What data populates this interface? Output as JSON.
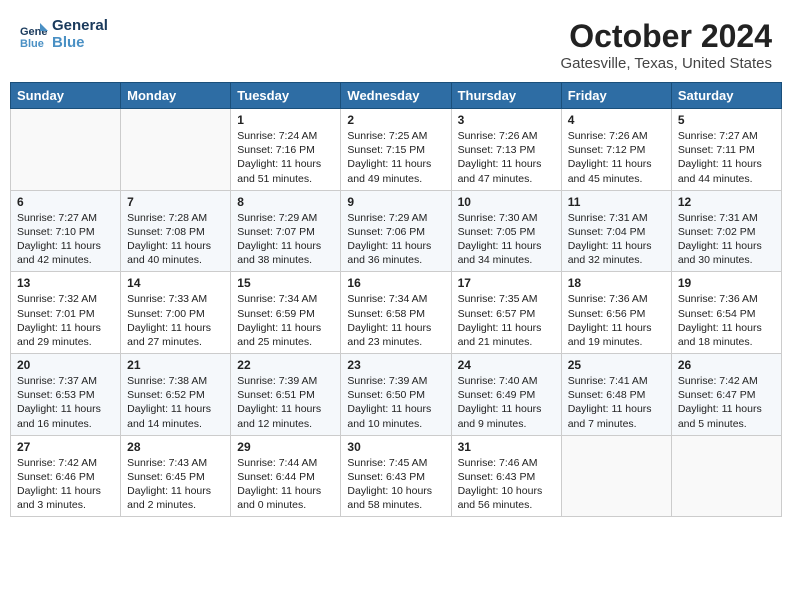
{
  "header": {
    "logo_line1": "General",
    "logo_line2": "Blue",
    "title": "October 2024",
    "subtitle": "Gatesville, Texas, United States"
  },
  "days_of_week": [
    "Sunday",
    "Monday",
    "Tuesday",
    "Wednesday",
    "Thursday",
    "Friday",
    "Saturday"
  ],
  "weeks": [
    [
      {
        "day": "",
        "info": ""
      },
      {
        "day": "",
        "info": ""
      },
      {
        "day": "1",
        "info": "Sunrise: 7:24 AM\nSunset: 7:16 PM\nDaylight: 11 hours and 51 minutes."
      },
      {
        "day": "2",
        "info": "Sunrise: 7:25 AM\nSunset: 7:15 PM\nDaylight: 11 hours and 49 minutes."
      },
      {
        "day": "3",
        "info": "Sunrise: 7:26 AM\nSunset: 7:13 PM\nDaylight: 11 hours and 47 minutes."
      },
      {
        "day": "4",
        "info": "Sunrise: 7:26 AM\nSunset: 7:12 PM\nDaylight: 11 hours and 45 minutes."
      },
      {
        "day": "5",
        "info": "Sunrise: 7:27 AM\nSunset: 7:11 PM\nDaylight: 11 hours and 44 minutes."
      }
    ],
    [
      {
        "day": "6",
        "info": "Sunrise: 7:27 AM\nSunset: 7:10 PM\nDaylight: 11 hours and 42 minutes."
      },
      {
        "day": "7",
        "info": "Sunrise: 7:28 AM\nSunset: 7:08 PM\nDaylight: 11 hours and 40 minutes."
      },
      {
        "day": "8",
        "info": "Sunrise: 7:29 AM\nSunset: 7:07 PM\nDaylight: 11 hours and 38 minutes."
      },
      {
        "day": "9",
        "info": "Sunrise: 7:29 AM\nSunset: 7:06 PM\nDaylight: 11 hours and 36 minutes."
      },
      {
        "day": "10",
        "info": "Sunrise: 7:30 AM\nSunset: 7:05 PM\nDaylight: 11 hours and 34 minutes."
      },
      {
        "day": "11",
        "info": "Sunrise: 7:31 AM\nSunset: 7:04 PM\nDaylight: 11 hours and 32 minutes."
      },
      {
        "day": "12",
        "info": "Sunrise: 7:31 AM\nSunset: 7:02 PM\nDaylight: 11 hours and 30 minutes."
      }
    ],
    [
      {
        "day": "13",
        "info": "Sunrise: 7:32 AM\nSunset: 7:01 PM\nDaylight: 11 hours and 29 minutes."
      },
      {
        "day": "14",
        "info": "Sunrise: 7:33 AM\nSunset: 7:00 PM\nDaylight: 11 hours and 27 minutes."
      },
      {
        "day": "15",
        "info": "Sunrise: 7:34 AM\nSunset: 6:59 PM\nDaylight: 11 hours and 25 minutes."
      },
      {
        "day": "16",
        "info": "Sunrise: 7:34 AM\nSunset: 6:58 PM\nDaylight: 11 hours and 23 minutes."
      },
      {
        "day": "17",
        "info": "Sunrise: 7:35 AM\nSunset: 6:57 PM\nDaylight: 11 hours and 21 minutes."
      },
      {
        "day": "18",
        "info": "Sunrise: 7:36 AM\nSunset: 6:56 PM\nDaylight: 11 hours and 19 minutes."
      },
      {
        "day": "19",
        "info": "Sunrise: 7:36 AM\nSunset: 6:54 PM\nDaylight: 11 hours and 18 minutes."
      }
    ],
    [
      {
        "day": "20",
        "info": "Sunrise: 7:37 AM\nSunset: 6:53 PM\nDaylight: 11 hours and 16 minutes."
      },
      {
        "day": "21",
        "info": "Sunrise: 7:38 AM\nSunset: 6:52 PM\nDaylight: 11 hours and 14 minutes."
      },
      {
        "day": "22",
        "info": "Sunrise: 7:39 AM\nSunset: 6:51 PM\nDaylight: 11 hours and 12 minutes."
      },
      {
        "day": "23",
        "info": "Sunrise: 7:39 AM\nSunset: 6:50 PM\nDaylight: 11 hours and 10 minutes."
      },
      {
        "day": "24",
        "info": "Sunrise: 7:40 AM\nSunset: 6:49 PM\nDaylight: 11 hours and 9 minutes."
      },
      {
        "day": "25",
        "info": "Sunrise: 7:41 AM\nSunset: 6:48 PM\nDaylight: 11 hours and 7 minutes."
      },
      {
        "day": "26",
        "info": "Sunrise: 7:42 AM\nSunset: 6:47 PM\nDaylight: 11 hours and 5 minutes."
      }
    ],
    [
      {
        "day": "27",
        "info": "Sunrise: 7:42 AM\nSunset: 6:46 PM\nDaylight: 11 hours and 3 minutes."
      },
      {
        "day": "28",
        "info": "Sunrise: 7:43 AM\nSunset: 6:45 PM\nDaylight: 11 hours and 2 minutes."
      },
      {
        "day": "29",
        "info": "Sunrise: 7:44 AM\nSunset: 6:44 PM\nDaylight: 11 hours and 0 minutes."
      },
      {
        "day": "30",
        "info": "Sunrise: 7:45 AM\nSunset: 6:43 PM\nDaylight: 10 hours and 58 minutes."
      },
      {
        "day": "31",
        "info": "Sunrise: 7:46 AM\nSunset: 6:43 PM\nDaylight: 10 hours and 56 minutes."
      },
      {
        "day": "",
        "info": ""
      },
      {
        "day": "",
        "info": ""
      }
    ]
  ]
}
